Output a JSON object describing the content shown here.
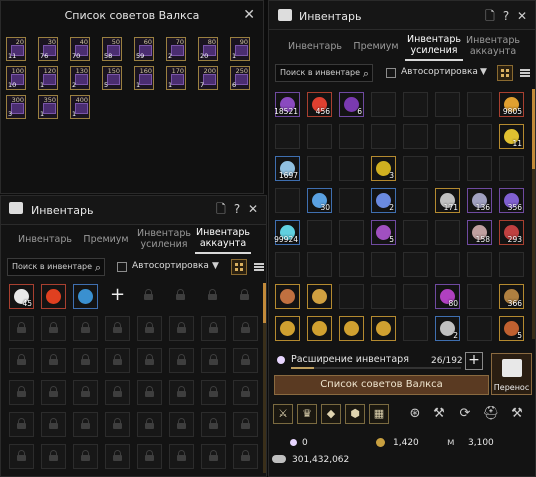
{
  "valks_window": {
    "title": "Список советов Валкса",
    "cards": [
      {
        "num": "20",
        "count": "11"
      },
      {
        "num": "30",
        "count": "76"
      },
      {
        "num": "40",
        "count": "70"
      },
      {
        "num": "50",
        "count": "58"
      },
      {
        "num": "60",
        "count": "59"
      },
      {
        "num": "70",
        "count": "2"
      },
      {
        "num": "80",
        "count": "20"
      },
      {
        "num": "90",
        "count": "1"
      },
      {
        "num": "100",
        "count": "10"
      },
      {
        "num": "120",
        "count": "1"
      },
      {
        "num": "130",
        "count": "2"
      },
      {
        "num": "150",
        "count": "5"
      },
      {
        "num": "160",
        "count": "1"
      },
      {
        "num": "170",
        "count": "1"
      },
      {
        "num": "200",
        "count": "7"
      },
      {
        "num": "250",
        "count": "6"
      },
      {
        "num": "300",
        "count": "3"
      },
      {
        "num": "350",
        "count": "1"
      },
      {
        "num": "400",
        "count": "1"
      }
    ]
  },
  "inv_small": {
    "title": "Инвентарь",
    "tabs": [
      "Инвентарь",
      "Премиум",
      "Инвентарь усиления",
      "Инвентарь аккаунта"
    ],
    "search_placeholder": "Поиск в инвентаре",
    "autosort": "Автосортировка",
    "items": [
      {
        "count": "45"
      },
      {
        "count": ""
      },
      {
        "count": ""
      }
    ],
    "add_label": "+"
  },
  "inv_main": {
    "title": "Инвентарь",
    "tabs": [
      "Инвентарь",
      "Премиум",
      "Инвентарь усиления",
      "Инвентарь аккаунта"
    ],
    "search_placeholder": "Поиск в инвентаре",
    "autosort": "Автосортировка",
    "item_counts": [
      "18521",
      "456",
      "6",
      "9805",
      "11",
      "1697",
      "3",
      "30",
      "2",
      "171",
      "136",
      "356",
      "99924",
      "5",
      "158",
      "293",
      "80",
      "366",
      "2",
      "5"
    ],
    "expand_label": "Расширение инвентаря",
    "expand_count": "26/192",
    "valks_button": "Список советов Валкса",
    "transfer_button": "Перенос",
    "currencies": {
      "pearls": "0",
      "coins": "1,420",
      "mileage": "3,100",
      "silver": "301,432,062"
    }
  }
}
